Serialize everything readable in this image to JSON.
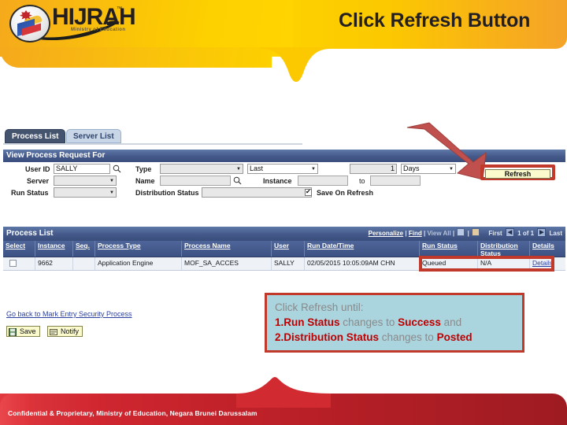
{
  "slide": {
    "title": "Click Refresh Button",
    "logo": {
      "name": "HIJRAH",
      "tm": "™",
      "tagline": "Ministry of Education"
    },
    "footer": "Confidential & Proprietary, Ministry of Education, Negara Brunei Darussalam",
    "colors": {
      "header_gold": "#FDD000",
      "header_orange": "#F4A32A",
      "footer_red": "#C0272D",
      "arrow_red": "#C0504D",
      "highlight_red": "#C0392B",
      "callout_bg": "#AAD4DE",
      "callout_text_red": "#C00000",
      "ps_header_blue": "#44598A"
    }
  },
  "app": {
    "tabs": [
      {
        "label": "Process List",
        "active": true
      },
      {
        "label": "Server List",
        "active": false
      }
    ],
    "section_header": "View Process Request For",
    "form": {
      "user_id_label": "User ID",
      "user_id_value": "SALLY",
      "user_id_lookup_icon": "magnifier-icon",
      "type_label": "Type",
      "type_value": "",
      "last_label": "Last",
      "last_value": "Last",
      "days_count_value": "1",
      "days_unit_value": "Days",
      "server_label": "Server",
      "server_value": "",
      "name_label": "Name",
      "name_value": "",
      "name_lookup_icon": "magnifier-icon",
      "instance_label": "Instance",
      "instance_from_value": "",
      "to_label": "to",
      "instance_to_value": "",
      "run_status_label": "Run Status",
      "run_status_value": "",
      "distribution_status_label": "Distribution Status",
      "distribution_status_value": "",
      "save_on_refresh_label": "Save On Refresh",
      "save_on_refresh_checked": true,
      "refresh_button": "Refresh"
    },
    "grid": {
      "title": "Process List",
      "actions": {
        "personalize": "Personalize",
        "find": "Find",
        "view_all": "View All",
        "sep": "|",
        "download_icon": "download-spreadsheet-icon",
        "expand_icon": "expand-grid-icon"
      },
      "pager": {
        "first": "First",
        "position": "1 of 1",
        "last": "Last",
        "prev_icon": "chevron-left-icon",
        "next_icon": "chevron-right-icon"
      },
      "columns": [
        "Select",
        "Instance",
        "Seq.",
        "Process Type",
        "Process Name",
        "User",
        "Run Date/Time",
        "Run Status",
        "Distribution Status",
        "Details"
      ],
      "rows": [
        {
          "select": "",
          "instance": "9662",
          "seq": "",
          "process_type": "Application Engine",
          "process_name": "MOF_SA_ACCES",
          "user": "SALLY",
          "run_datetime": "02/05/2015 10:05:09AM CHN",
          "run_status": "Queued",
          "distribution_status": "N/A",
          "details": "Details"
        }
      ]
    },
    "back_link": "Go back to Mark Entry Security Process",
    "buttons": [
      {
        "label": "Save",
        "icon": "save-disk-icon"
      },
      {
        "label": "Notify",
        "icon": "notify-envelope-icon"
      }
    ]
  },
  "callout": {
    "line1_plain": "Click Refresh until:",
    "line2_num": "1.",
    "line2_bold1": "Run Status",
    "line2_mid": " changes to ",
    "line2_bold2": "Success",
    "line2_tail": " and",
    "line3_num": "2.",
    "line3_bold1": "Distribution Status",
    "line3_mid": " changes to ",
    "line3_bold2": "Posted"
  }
}
